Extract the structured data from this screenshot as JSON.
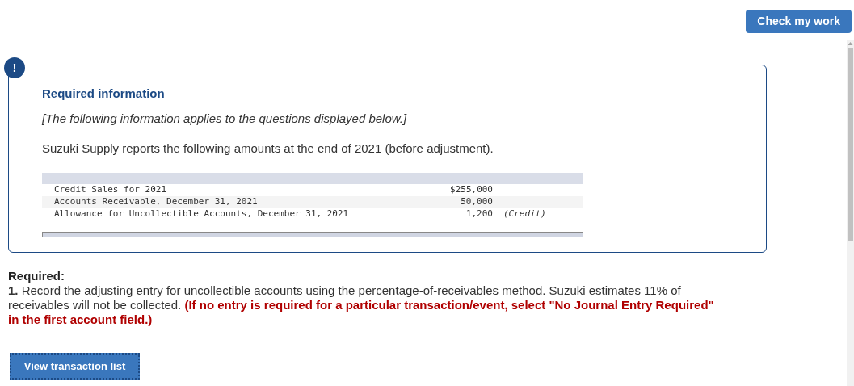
{
  "check_button": "Check my work",
  "info_card": {
    "icon": "!",
    "title": "Required information",
    "note": "[The following information applies to the questions displayed below.]",
    "intro": "Suzuki Supply reports the following amounts at the end of 2021 (before adjustment).",
    "table": {
      "rows": [
        {
          "label": "Credit Sales for 2021",
          "amount": "$255,000"
        },
        {
          "label": "Accounts Receivable, December 31, 2021",
          "amount": "50,000"
        },
        {
          "label": "Allowance for Uncollectible Accounts, December 31, 2021",
          "amount": "1,200",
          "note": "(Credit)"
        }
      ]
    }
  },
  "required": {
    "heading": "Required:",
    "number": "1.",
    "text": "Record the adjusting entry for uncollectible accounts using the percentage-of-receivables method. Suzuki estimates 11% of receivables will not be collected.",
    "instruction": "(If no entry is required for a particular transaction/event, select \"No Journal Entry Required\" in the first account field.)"
  },
  "view_button": "View transaction list"
}
